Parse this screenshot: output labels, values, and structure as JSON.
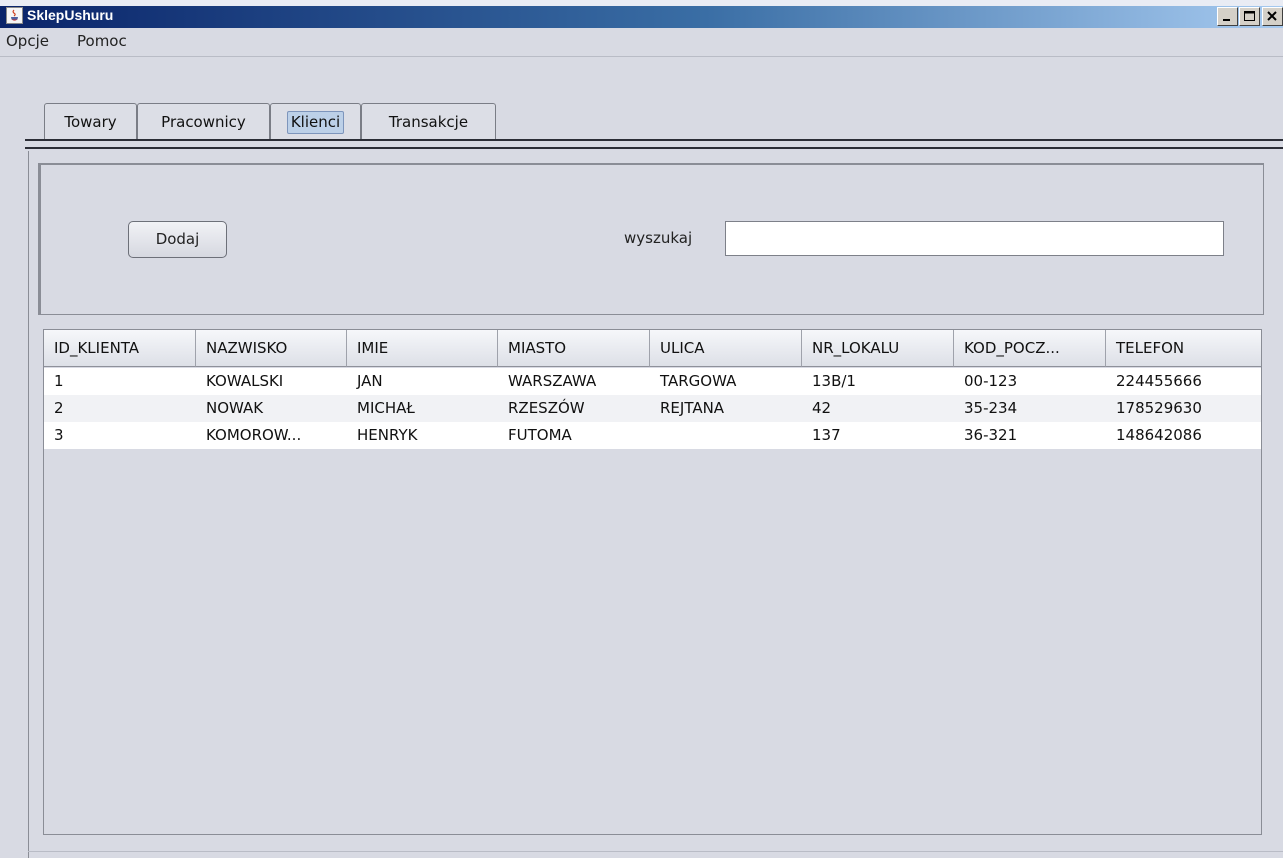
{
  "window": {
    "title": "SklepUshuru",
    "controls": [
      "minimize",
      "maximize",
      "close"
    ]
  },
  "menu": {
    "items": [
      "Opcje",
      "Pomoc"
    ]
  },
  "tabs": {
    "items": [
      "Towary",
      "Pracownicy",
      "Klienci",
      "Transakcje"
    ],
    "active": "Klienci"
  },
  "toolbar": {
    "add_label": "Dodaj",
    "search_label": "wyszukaj",
    "search_value": ""
  },
  "table": {
    "columns": [
      "ID_KLIENTA",
      "NAZWISKO",
      "IMIE",
      "MIASTO",
      "ULICA",
      "NR_LOKALU",
      "KOD_POCZ...",
      "TELEFON"
    ],
    "rows": [
      [
        "1",
        "KOWALSKI",
        "JAN",
        "WARSZAWA",
        "TARGOWA",
        "13B/1",
        "00-123",
        "224455666"
      ],
      [
        "2",
        "NOWAK",
        "MICHAŁ",
        "RZESZÓW",
        "REJTANA",
        "42",
        "35-234",
        "178529630"
      ],
      [
        "3",
        "KOMOROW...",
        "HENRYK",
        "FUTOMA",
        "",
        "137",
        "36-321",
        "148642086"
      ]
    ]
  },
  "colors": {
    "title_gradient_start": "#0a246a",
    "title_gradient_end": "#a6caf0",
    "background": "#d8dae3",
    "active_tab": "#bcd0e8"
  }
}
